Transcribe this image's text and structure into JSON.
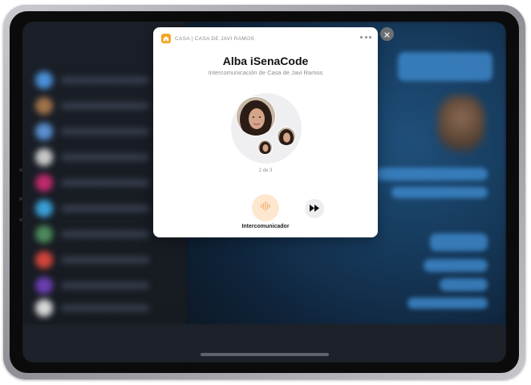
{
  "header": {
    "label": "CASA | CASA DE JAVI RAMOS",
    "icon": "home-icon",
    "more_icon": "more-icon"
  },
  "card": {
    "title": "Alba iSenaCode",
    "subtitle": "Intercomunicación de Casa de Javi Ramos",
    "pager": "2 de 3"
  },
  "actions": {
    "intercom_label": "Intercomunicador",
    "intercom_icon": "waveform-icon",
    "skip_icon": "fast-forward-icon"
  },
  "close_icon": "close-icon",
  "colors": {
    "accent": "#f5a623",
    "intercom_bg": "#fde7cf",
    "intercom_glyph": "#f2b47a"
  }
}
